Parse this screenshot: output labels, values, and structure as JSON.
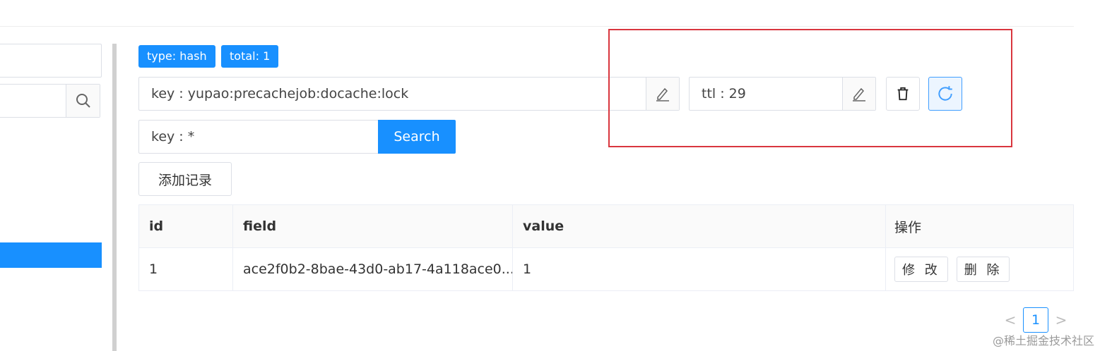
{
  "tags": {
    "type": "type: hash",
    "total": "total: 1"
  },
  "key_field": {
    "value": "key : yupao:precachejob:docache:lock"
  },
  "ttl_field": {
    "value": "ttl : 29"
  },
  "search": {
    "query": "key : *",
    "button": "Search"
  },
  "add_button": "添加记录",
  "table": {
    "headers": [
      "id",
      "field",
      "value",
      "操作"
    ],
    "rows": [
      {
        "id": "1",
        "field": "ace2f0b2-8bae-43d0-ab17-4a118ace0...",
        "value": "1",
        "edit": "修 改",
        "delete": "删 除"
      }
    ]
  },
  "pagination": {
    "prev": "<",
    "current": "1",
    "next": ">"
  },
  "watermark": "@稀土掘金技术社区",
  "colors": {
    "primary": "#1890ff",
    "highlight_box": "#d9363e"
  },
  "icons": [
    "search-icon",
    "edit-icon",
    "trash-icon",
    "refresh-icon"
  ]
}
